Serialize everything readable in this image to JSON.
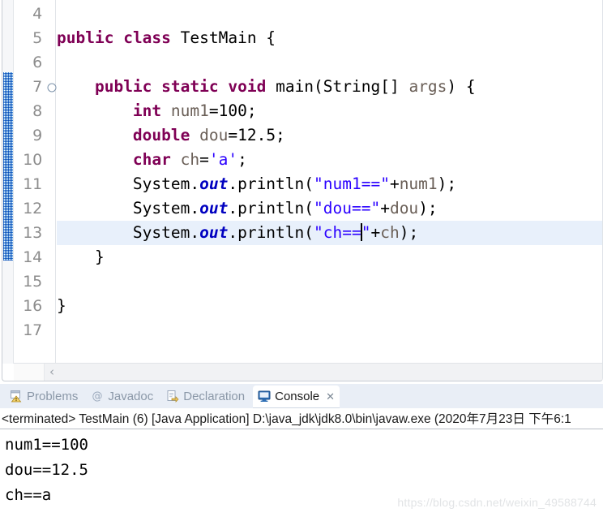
{
  "editor": {
    "first_line_number": 4,
    "highlighted_line": 13,
    "folding_marker_line": 7,
    "annotation_range_lines": [
      7,
      14
    ],
    "colors": {
      "keyword": "#7f0055",
      "string": "#2a00ff",
      "field": "#0000c0",
      "variable": "#6a5f57",
      "plain": "#000000",
      "current_line_highlight": "#e8f0fb",
      "line_number": "#8c8c8c",
      "annotation_bar": "#2b7fd4"
    },
    "scrollbar": {
      "left_arrow": "‹"
    },
    "lines": [
      {
        "num": "4",
        "tokens": []
      },
      {
        "num": "5",
        "tokens": [
          {
            "t": "public",
            "c": "kw"
          },
          {
            "t": " ",
            "c": "pln"
          },
          {
            "t": "class",
            "c": "kw"
          },
          {
            "t": " TestMain {",
            "c": "pln"
          }
        ]
      },
      {
        "num": "6",
        "tokens": []
      },
      {
        "num": "7",
        "fold": true,
        "tokens": [
          {
            "t": "    ",
            "c": "pln"
          },
          {
            "t": "public",
            "c": "kw"
          },
          {
            "t": " ",
            "c": "pln"
          },
          {
            "t": "static",
            "c": "kw"
          },
          {
            "t": " ",
            "c": "pln"
          },
          {
            "t": "void",
            "c": "kw"
          },
          {
            "t": " main(String[] ",
            "c": "pln"
          },
          {
            "t": "args",
            "c": "var"
          },
          {
            "t": ") {",
            "c": "pln"
          }
        ]
      },
      {
        "num": "8",
        "tokens": [
          {
            "t": "        ",
            "c": "pln"
          },
          {
            "t": "int",
            "c": "kw"
          },
          {
            "t": " ",
            "c": "pln"
          },
          {
            "t": "num1",
            "c": "var"
          },
          {
            "t": "=100;",
            "c": "pln"
          }
        ]
      },
      {
        "num": "9",
        "tokens": [
          {
            "t": "        ",
            "c": "pln"
          },
          {
            "t": "double",
            "c": "kw"
          },
          {
            "t": " ",
            "c": "pln"
          },
          {
            "t": "dou",
            "c": "var"
          },
          {
            "t": "=12.5;",
            "c": "pln"
          }
        ]
      },
      {
        "num": "10",
        "tokens": [
          {
            "t": "        ",
            "c": "pln"
          },
          {
            "t": "char",
            "c": "kw"
          },
          {
            "t": " ",
            "c": "pln"
          },
          {
            "t": "ch",
            "c": "var"
          },
          {
            "t": "=",
            "c": "pln"
          },
          {
            "t": "'a'",
            "c": "str"
          },
          {
            "t": ";",
            "c": "pln"
          }
        ]
      },
      {
        "num": "11",
        "tokens": [
          {
            "t": "        System.",
            "c": "pln"
          },
          {
            "t": "out",
            "c": "fld"
          },
          {
            "t": ".println(",
            "c": "pln"
          },
          {
            "t": "\"num1==\"",
            "c": "str"
          },
          {
            "t": "+",
            "c": "pln"
          },
          {
            "t": "num1",
            "c": "var"
          },
          {
            "t": ");",
            "c": "pln"
          }
        ]
      },
      {
        "num": "12",
        "tokens": [
          {
            "t": "        System.",
            "c": "pln"
          },
          {
            "t": "out",
            "c": "fld"
          },
          {
            "t": ".println(",
            "c": "pln"
          },
          {
            "t": "\"dou==\"",
            "c": "str"
          },
          {
            "t": "+",
            "c": "pln"
          },
          {
            "t": "dou",
            "c": "var"
          },
          {
            "t": ");",
            "c": "pln"
          }
        ]
      },
      {
        "num": "13",
        "highlight": true,
        "tokens": [
          {
            "t": "        System.",
            "c": "pln"
          },
          {
            "t": "out",
            "c": "fld"
          },
          {
            "t": ".println(",
            "c": "pln"
          },
          {
            "t": "\"ch==",
            "c": "str"
          },
          {
            "t": "",
            "c": "caret"
          },
          {
            "t": "\"",
            "c": "str"
          },
          {
            "t": "+",
            "c": "pln"
          },
          {
            "t": "ch",
            "c": "var"
          },
          {
            "t": ");",
            "c": "pln"
          }
        ]
      },
      {
        "num": "14",
        "tokens": [
          {
            "t": "    }",
            "c": "pln"
          }
        ]
      },
      {
        "num": "15",
        "tokens": []
      },
      {
        "num": "16",
        "tokens": [
          {
            "t": "}",
            "c": "pln"
          }
        ]
      },
      {
        "num": "17",
        "tokens": []
      }
    ]
  },
  "bottom_panel": {
    "tabs": [
      {
        "label": "Problems",
        "icon": "problems-icon",
        "active": false
      },
      {
        "label": "Javadoc",
        "icon": "javadoc-icon",
        "active": false
      },
      {
        "label": "Declaration",
        "icon": "declaration-icon",
        "active": false
      },
      {
        "label": "Console",
        "icon": "console-icon",
        "active": true,
        "close": "✕"
      }
    ],
    "terminated_line": "<terminated> TestMain (6) [Java Application] D:\\java_jdk\\jdk8.0\\bin\\javaw.exe (2020年7月23日 下午6:1",
    "console_output": [
      "num1==100",
      "dou==12.5",
      "ch==a"
    ]
  },
  "watermark": "https://blog.csdn.net/weixin_49588744"
}
